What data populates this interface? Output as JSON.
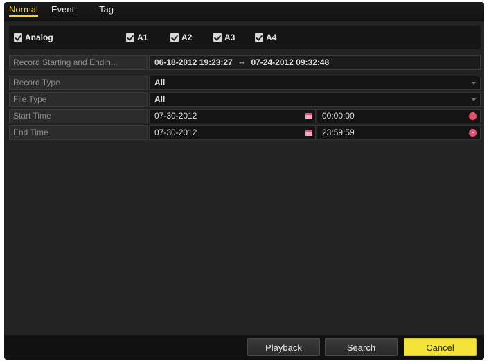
{
  "tabs": [
    {
      "label": "Normal",
      "active": true
    },
    {
      "label": "Event",
      "active": false
    },
    {
      "label": "Tag",
      "active": false
    }
  ],
  "cameras": {
    "group_label": "Analog",
    "group_checked": true,
    "items": [
      {
        "label": "A1",
        "checked": true
      },
      {
        "label": "A2",
        "checked": true
      },
      {
        "label": "A3",
        "checked": true
      },
      {
        "label": "A4",
        "checked": true
      }
    ]
  },
  "record_range": {
    "label": "Record Starting and Endin...",
    "start": "06-18-2012 19:23:27",
    "separator": "--",
    "end": "07-24-2012 09:32:48"
  },
  "fields": {
    "record_type": {
      "label": "Record Type",
      "value": "All"
    },
    "file_type": {
      "label": "File Type",
      "value": "All"
    },
    "start_time": {
      "label": "Start Time",
      "date": "07-30-2012",
      "time": "00:00:00"
    },
    "end_time": {
      "label": "End Time",
      "date": "07-30-2012",
      "time": "23:59:59"
    }
  },
  "buttons": {
    "playback": "Playback",
    "search": "Search",
    "cancel": "Cancel"
  },
  "icons": [
    "checkbox-icon",
    "dropdown-arrow-icon",
    "calendar-icon",
    "clock-icon"
  ]
}
